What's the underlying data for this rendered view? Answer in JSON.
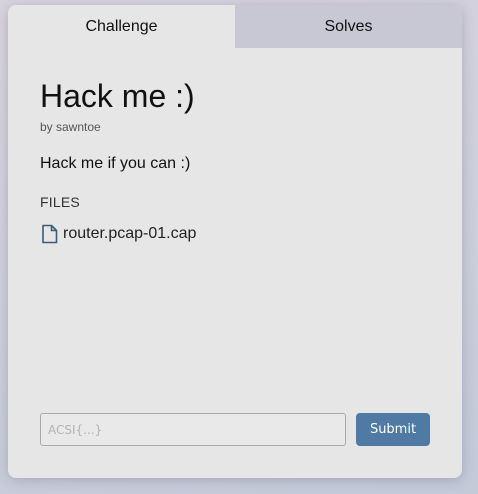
{
  "tabs": [
    {
      "label": "Challenge",
      "active": true
    },
    {
      "label": "Solves",
      "active": false
    }
  ],
  "challenge": {
    "title": "Hack me :)",
    "author": "by sawntoe",
    "description": "Hack me if you can :)"
  },
  "files": {
    "label": "FILES",
    "items": [
      {
        "name": "router.pcap-01.cap",
        "icon": "file-icon"
      }
    ]
  },
  "submission": {
    "placeholder": "ACSI{...}",
    "submit_label": "Submit"
  },
  "colors": {
    "accent": "#4e7aa3",
    "panel": "#e6e6e6",
    "inactive_tab": "#c7c8d4"
  }
}
